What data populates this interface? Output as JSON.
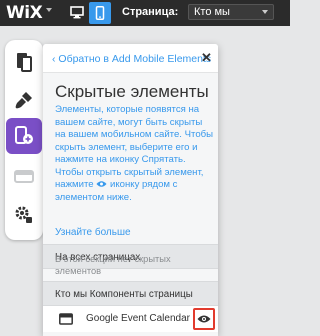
{
  "topbar": {
    "logo": "WiX",
    "page_label": "Страница:",
    "page_select_value": "Кто мы"
  },
  "rail": {
    "items": [
      {
        "icon": "pages-icon",
        "active": false
      },
      {
        "icon": "design-icon",
        "active": false
      },
      {
        "icon": "add-mobile-elements-icon",
        "active": true
      },
      {
        "icon": "app-icon",
        "active": false
      },
      {
        "icon": "settings-icon",
        "active": false
      }
    ]
  },
  "panel": {
    "back_label": "‹ Обратно в Add Mobile Elements",
    "close_label": "✕",
    "title": "Скрытые элементы",
    "desc_1": "Элементы, которые появятся на вашем сайте, могут быть скрыты на вашем мобильном сайте. Чтобы скрыть элемент, выберите его и нажмите на иконку Спрятать. Чтобы открыть скрытый элемент, нажмите",
    "desc_2": "иконку рядом с элементом ниже.",
    "learn_more": "Узнайте больше",
    "section_all_pages": "На всех страницах",
    "empty_note": "В этой секции нет скрытых элементов",
    "section_page_components": "Кто мы Компоненты страницы",
    "rows": [
      {
        "label": "Google Event Calendar"
      }
    ]
  },
  "colors": {
    "topbar_bg": "#2b2b2b",
    "accent_blue": "#3899ec",
    "active_purple": "#7a4fc6",
    "highlight_red": "#e23b2e"
  }
}
